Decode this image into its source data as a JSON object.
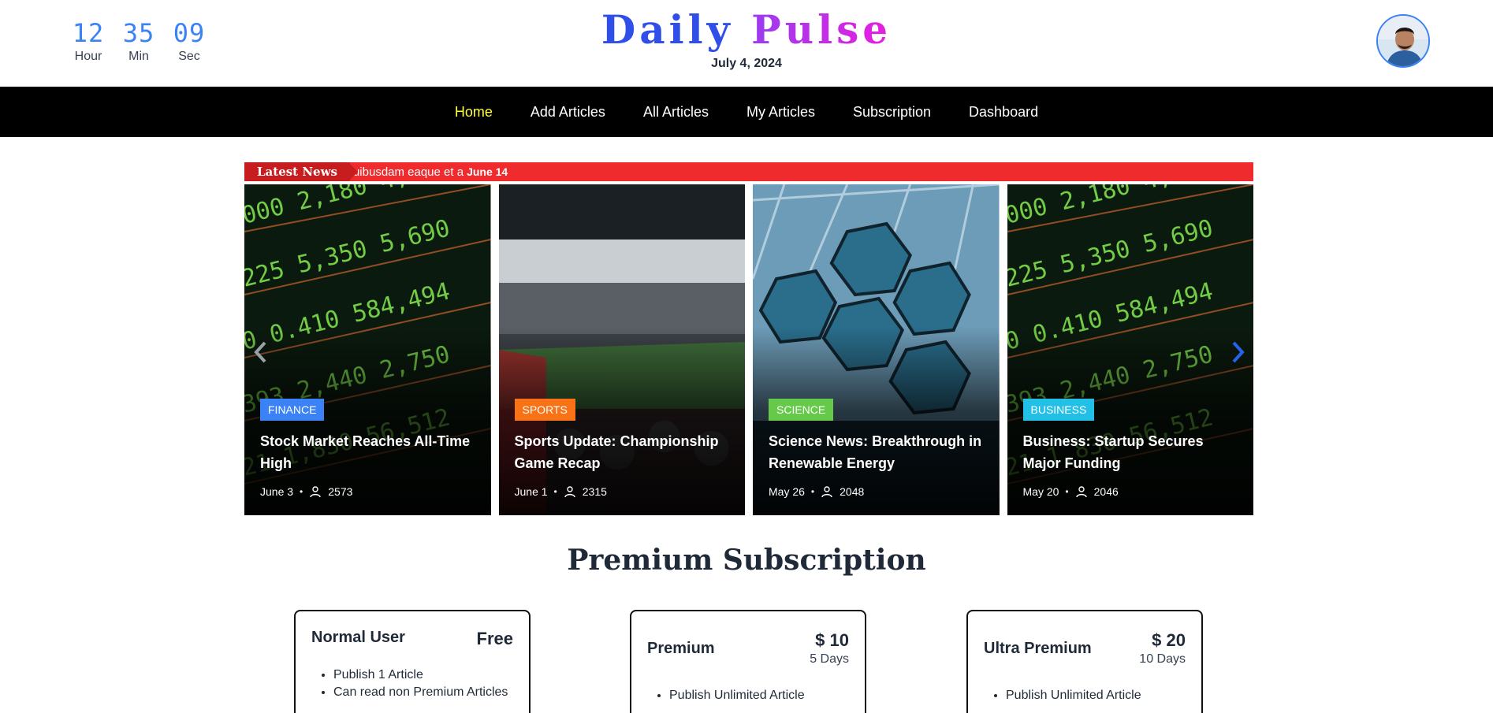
{
  "clock": {
    "hour": "12",
    "minute": "35",
    "second": "09",
    "hour_label": "Hour",
    "minute_label": "Min",
    "second_label": "Sec"
  },
  "brand": {
    "word1": "Daily",
    "word2": "Pulse",
    "date": "July 4, 2024"
  },
  "nav": {
    "items": [
      "Home",
      "Add Articles",
      "All Articles",
      "My Articles",
      "Subscription",
      "Dashboard"
    ],
    "active": "Home"
  },
  "ticker": {
    "label": "Latest News",
    "text": "uibusdam eaque et a",
    "date": "June 14"
  },
  "cards": [
    {
      "tag": "FINANCE",
      "tag_color": "#3b82f6",
      "title": "Stock Market Reaches All-Time High",
      "date": "June 3",
      "views": "2573",
      "image": "stock-board"
    },
    {
      "tag": "SPORTS",
      "tag_color": "#f97316",
      "title": "Sports Update: Championship Game Recap",
      "date": "June 1",
      "views": "2315",
      "image": "stadium"
    },
    {
      "tag": "SCIENCE",
      "tag_color": "#65c94a",
      "title": "Science News: Breakthrough in Renewable Energy",
      "date": "May 26",
      "views": "2048",
      "image": "telescope-mirror"
    },
    {
      "tag": "BUSINESS",
      "tag_color": "#22c0e6",
      "title": "Business: Startup Secures Major Funding",
      "date": "May 20",
      "views": "2046",
      "image": "stock-board"
    }
  ],
  "subscription": {
    "title": "Premium Subscription",
    "plans": [
      {
        "name": "Normal User",
        "price": "Free",
        "period": "",
        "features": [
          "Publish 1 Article",
          "Can read non Premium Articles"
        ]
      },
      {
        "name": "Premium",
        "price": "$ 10",
        "period": "5 Days",
        "features": [
          "Publish Unlimited Article"
        ]
      },
      {
        "name": "Ultra Premium",
        "price": "$ 20",
        "period": "10 Days",
        "features": [
          "Publish Unlimited Article"
        ]
      }
    ]
  },
  "colors": {
    "accent_blue": "#3b82f6",
    "nav_bg": "#000000",
    "nav_active": "#ffff3b",
    "ticker_red": "#ef2b2d"
  },
  "icons": {
    "prev": "chevron-left-icon",
    "next": "chevron-right-icon",
    "views": "user-icon"
  }
}
